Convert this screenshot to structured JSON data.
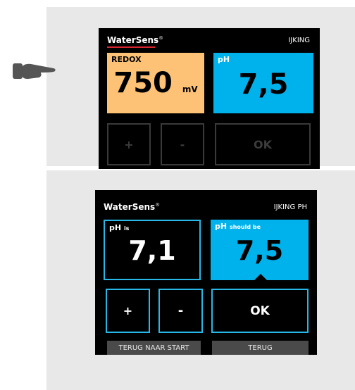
{
  "top_screen": {
    "brand": "WaterSens",
    "brand_mark": "®",
    "header_title": "IJKING",
    "redox_label": "REDOX",
    "redox_value": "750",
    "redox_unit": "mV",
    "ph_label": "pH",
    "ph_value": "7,5",
    "plus_label": "+",
    "minus_label": "-",
    "ok_label": "OK"
  },
  "bottom_screen": {
    "brand": "WaterSens",
    "brand_mark": "®",
    "header_title": "IJKING PH",
    "ph_is_label": "pH",
    "ph_is_suffix": "is",
    "ph_is_value": "7,1",
    "ph_should_label": "pH",
    "ph_should_suffix": "should be",
    "ph_should_value": "7,5",
    "plus_label": "+",
    "minus_label": "-",
    "ok_label": "OK",
    "back_to_start_label": "TERUG NAAR START",
    "back_label": "TERUG"
  },
  "colors": {
    "redox_tile": "#fdc276",
    "ph_tile": "#00b2ec",
    "button_border": "#27b8e8",
    "brand_underline": "#d9232e"
  },
  "icons": {
    "pointer": "pointing-hand-icon"
  }
}
